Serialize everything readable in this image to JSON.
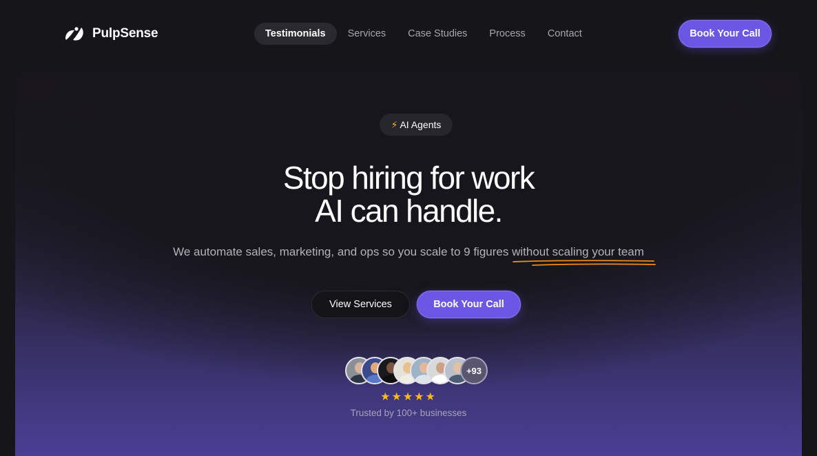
{
  "brand": {
    "name": "PulpSense",
    "logo_icon": "pulpsense-logo-icon"
  },
  "nav": {
    "items": [
      {
        "label": "Testimonials",
        "active": true
      },
      {
        "label": "Services",
        "active": false
      },
      {
        "label": "Case Studies",
        "active": false
      },
      {
        "label": "Process",
        "active": false
      },
      {
        "label": "Contact",
        "active": false
      }
    ]
  },
  "header": {
    "cta_label": "Book Your Call"
  },
  "hero": {
    "badge": {
      "icon": "lightning-bolt-icon",
      "label": "AI Agents"
    },
    "headline_line1": "Stop hiring for work",
    "headline_line2": "AI can handle.",
    "subtext_main": "We automate sales, marketing, and ops so you scale to 9 figures",
    "subtext_highlight": "without scaling your team",
    "secondary_button": "View Services",
    "primary_button": "Book Your Call"
  },
  "social_proof": {
    "avatar_count_visible": 7,
    "more_count": "+93",
    "rating_stars": 5,
    "stars_text": "★★★★★",
    "trusted_text": "Trusted by 100+ businesses"
  },
  "colors": {
    "accent": "#6b57e3",
    "background": "#16151a",
    "star": "#f5bb17",
    "underline": "#f28b1e"
  }
}
